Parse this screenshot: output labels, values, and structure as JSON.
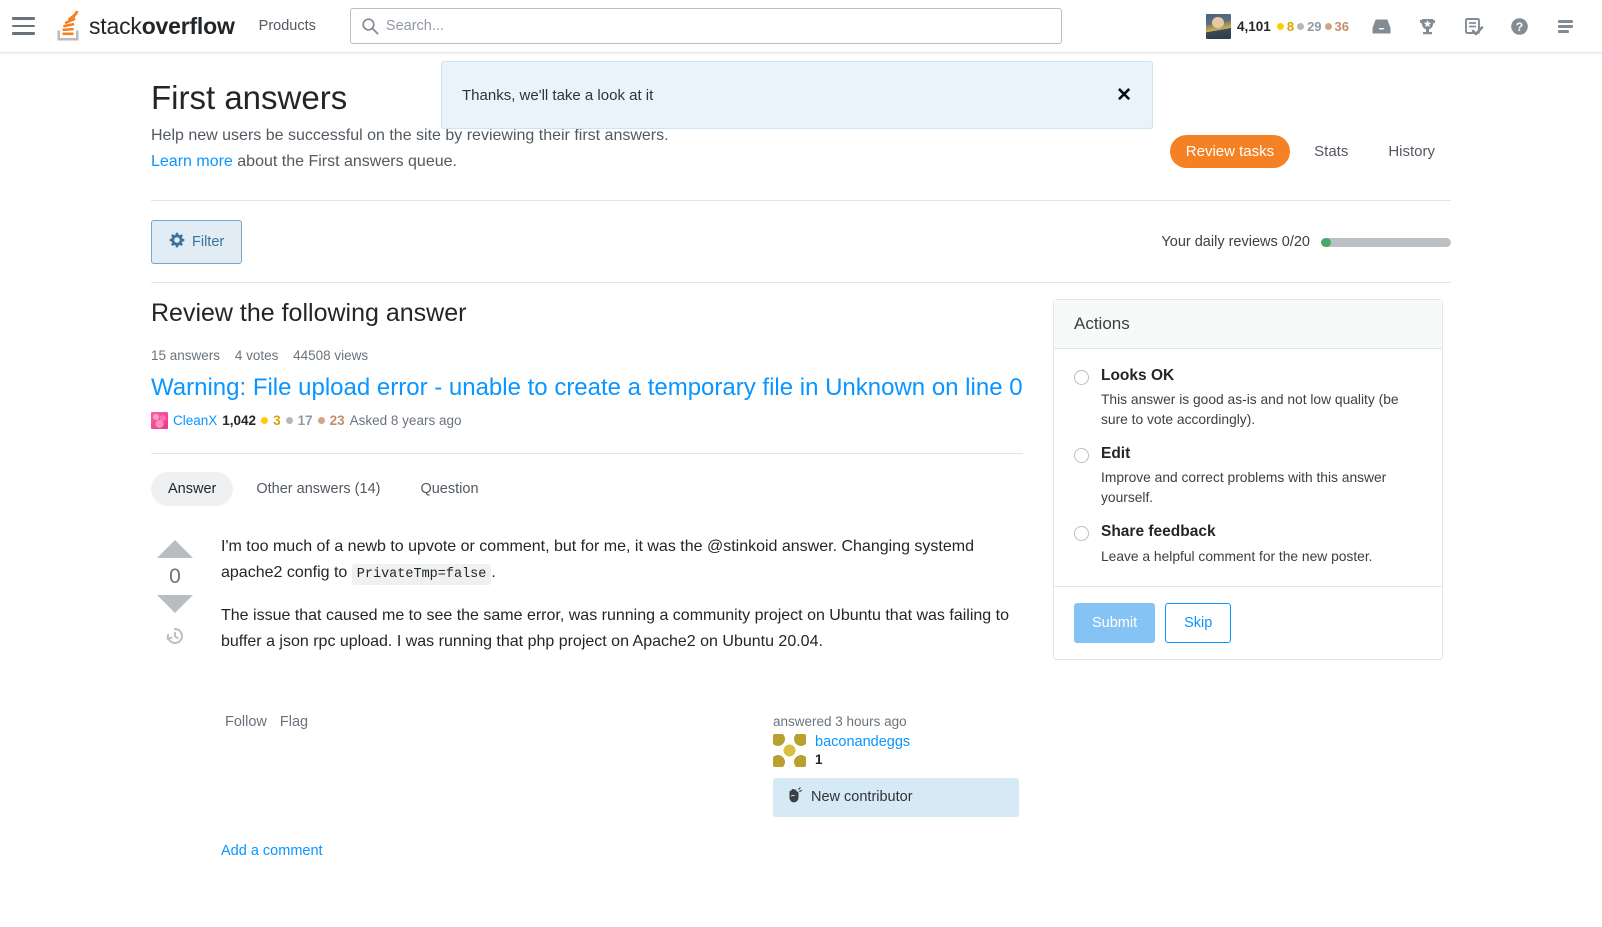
{
  "header": {
    "menu_icon": "hamburger-icon",
    "logo_light": "stack",
    "logo_bold": "overflow",
    "products_label": "Products",
    "search": {
      "placeholder": "Search...",
      "value": "",
      "icon": "search-icon"
    },
    "user": {
      "reputation": "4,101",
      "gold": "8",
      "silver": "29",
      "bronze": "36"
    },
    "icons": [
      "inbox-icon",
      "trophy-icon",
      "review-queue-icon",
      "help-icon",
      "stack-menu-icon"
    ]
  },
  "queue": {
    "title": "First answers",
    "description": "Help new users be successful on the site by reviewing their first answers.",
    "learn_more": "Learn more",
    "learn_more_suffix": " about the First answers queue.",
    "toast": {
      "message": "Thanks, we'll take a look at it",
      "close_icon": "close-icon"
    },
    "tabs": [
      {
        "label": "Review tasks",
        "active": true
      },
      {
        "label": "Stats",
        "active": false
      },
      {
        "label": "History",
        "active": false
      }
    ],
    "filter_label": "Filter",
    "filter_icon": "gear-icon",
    "daily_reviews_label": "Your daily reviews 0/20",
    "daily_progress_percent": 0
  },
  "review": {
    "section_heading": "Review the following answer",
    "stats": {
      "answers": "15 answers",
      "votes": "4 votes",
      "views": "44508 views"
    },
    "question_title": "Warning: File upload error - unable to create a temporary file in Unknown on line 0",
    "asker": {
      "name": "CleanX",
      "reputation": "1,042",
      "gold": "3",
      "silver": "17",
      "bronze": "23",
      "asked": "Asked 8 years ago"
    },
    "tabs": [
      {
        "label": "Answer",
        "active": true
      },
      {
        "label": "Other answers (14)",
        "active": false
      },
      {
        "label": "Question",
        "active": false
      }
    ],
    "vote_count": "0",
    "up_icon": "upvote-arrow-icon",
    "down_icon": "downvote-arrow-icon",
    "history_icon": "post-history-icon",
    "body": {
      "p1_before": "I'm too much of a newb to upvote or comment, but for me, it was the @stinkoid answer. Changing systemd apache2 config to ",
      "p1_code": "PrivateTmp=false",
      "p1_after": ".",
      "p2": "The issue that caused me to see the same error, was running a community project on Ubuntu that was failing to buffer a json rpc upload. I was running that php project on Apache2 on Ubuntu 20.04."
    },
    "follow_label": "Follow",
    "flag_label": "Flag",
    "answerer": {
      "time": "answered 3 hours ago",
      "name": "baconandeggs",
      "reputation": "1",
      "badge_label": "New contributor",
      "badge_icon": "waving-hand-icon"
    },
    "add_comment_label": "Add a comment"
  },
  "actions": {
    "heading": "Actions",
    "options": [
      {
        "title": "Looks OK",
        "description": "This answer is good as-is and not low quality (be sure to vote accordingly)."
      },
      {
        "title": "Edit",
        "description": "Improve and correct problems with this answer yourself."
      },
      {
        "title": "Share feedback",
        "description": "Leave a helpful comment for the new poster."
      }
    ],
    "submit_label": "Submit",
    "skip_label": "Skip"
  },
  "colors": {
    "accent_orange": "#f48225",
    "link_blue": "#0a95ff",
    "toast_bg": "#e8f3fb",
    "progress_green": "#48a868"
  }
}
